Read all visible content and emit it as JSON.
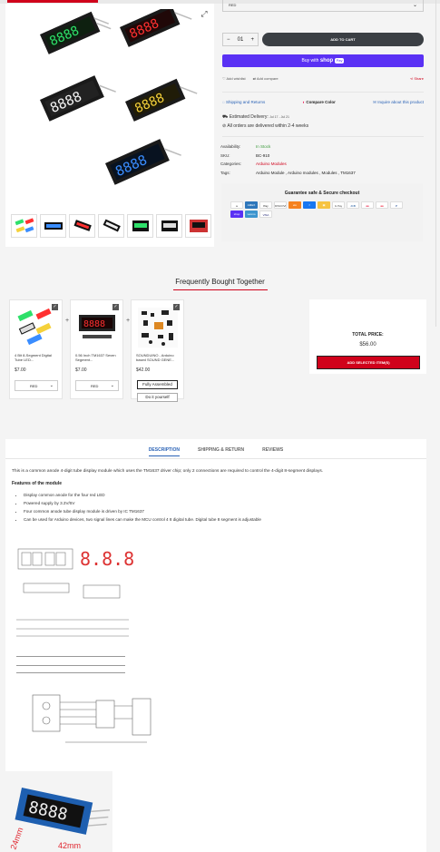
{
  "variant_select": {
    "value": "RED"
  },
  "quantity": {
    "value": "01",
    "minus": "−",
    "plus": "+"
  },
  "add_to_cart": "ADD TO CART",
  "shop_pay": {
    "prefix": "Buy with",
    "brand": "shop",
    "pay": "Pay"
  },
  "links": {
    "wishlist": "Add wishlist",
    "compare": "Add compare",
    "share": "Share"
  },
  "links2": {
    "shipping": "Shipping and Returns",
    "compare_color": "Compare Color",
    "inquire": "Inquire about this product"
  },
  "delivery": {
    "label": "Estimated Delivery:",
    "dates": "Jul 17 - Jul 21",
    "note": "All orders are delivered within 2-4 weeks"
  },
  "meta": {
    "availability_label": "Availability:",
    "availability": "In Stock",
    "sku_label": "SKU:",
    "sku": "BC-910",
    "categories_label": "Categories:",
    "categories": "Arduino Modules",
    "tags_label": "Tags:",
    "tags": "Arduino Module , Arduino modules , Modules , TM1637"
  },
  "guarantee": {
    "title": "Guarantee safe & Secure checkout"
  },
  "payment_icons": [
    {
      "name": "amazon",
      "label": "a",
      "color": "#ffffff",
      "fg": "#222"
    },
    {
      "name": "amex",
      "label": "AMEX",
      "color": "#2e77bb",
      "fg": "#fff"
    },
    {
      "name": "apple-pay",
      "label": "Pay",
      "color": "#ffffff",
      "fg": "#000"
    },
    {
      "name": "discover",
      "label": "DISCOVER",
      "color": "#ffffff",
      "fg": "#333"
    },
    {
      "name": "elo",
      "label": "elo",
      "color": "#f58220",
      "fg": "#fff"
    },
    {
      "name": "facebook-pay",
      "label": "f",
      "color": "#1877f2",
      "fg": "#fff"
    },
    {
      "name": "gift-card",
      "label": "▣",
      "color": "#f6c343",
      "fg": "#fff"
    },
    {
      "name": "google-pay",
      "label": "G Pay",
      "color": "#ffffff",
      "fg": "#444"
    },
    {
      "name": "jcb",
      "label": "JCB",
      "color": "#ffffff",
      "fg": "#0e4c96"
    },
    {
      "name": "maestro",
      "label": "●●",
      "color": "#ffffff",
      "fg": "#e4002b"
    },
    {
      "name": "mastercard",
      "label": "●●",
      "color": "#ffffff",
      "fg": "#eb001b"
    },
    {
      "name": "paypal",
      "label": "P",
      "color": "#ffffff",
      "fg": "#003087"
    },
    {
      "name": "shop-pay",
      "label": "shop",
      "color": "#5a31f4",
      "fg": "#fff"
    },
    {
      "name": "venmo",
      "label": "venmo",
      "color": "#3d95ce",
      "fg": "#fff"
    },
    {
      "name": "visa",
      "label": "VISA",
      "color": "#ffffff",
      "fg": "#1a1f71"
    }
  ],
  "fbt": {
    "title": "Frequently Bought Together",
    "items": [
      {
        "name": "4 Bit 8-Segment Digital Tube LED...",
        "price": "$7.00",
        "variant": "RED"
      },
      {
        "name": "0.56 Inch TM1637 Seven Segment...",
        "price": "$7.00",
        "variant": "RED"
      },
      {
        "name": "SOUNDUINO - Arduino based SOUND GENE...",
        "price": "$42.00",
        "option1": "Fully Assembled",
        "option2": "Do it yourself"
      }
    ],
    "plus": "+",
    "total_label": "TOTAL PRICE:",
    "total": "$56.00",
    "add_button": "ADD SELECTED ITEM(S)"
  },
  "tabs": {
    "description": "DESCRIPTION",
    "shipping": "SHIPPING & RETURN",
    "reviews": "REVIEWS"
  },
  "description": {
    "intro": "This is a common anode 4-digit tube display module which uses the TM1637 driver chip; only 2 connections are required to control the 4-digit 8-segment displays.",
    "features_title": "Features of the module",
    "features": [
      "Display common anode for the four red LED",
      "Powered supply by 3.3V/5V",
      "Four common anode tube display module is driven by IC TM1637",
      "Can be used for Arduino devices, two signal lines can make the MCU control 4 8 digital tube. Digital tube 8 segment is adjustable"
    ]
  },
  "photo_dims": {
    "width": "42mm",
    "height": "24mm"
  },
  "colors": {
    "accent": "#d0021b",
    "link": "#2b63b6",
    "cart": "#3b3f44",
    "shop": "#5a31f4",
    "instock": "#3c9a3c"
  }
}
